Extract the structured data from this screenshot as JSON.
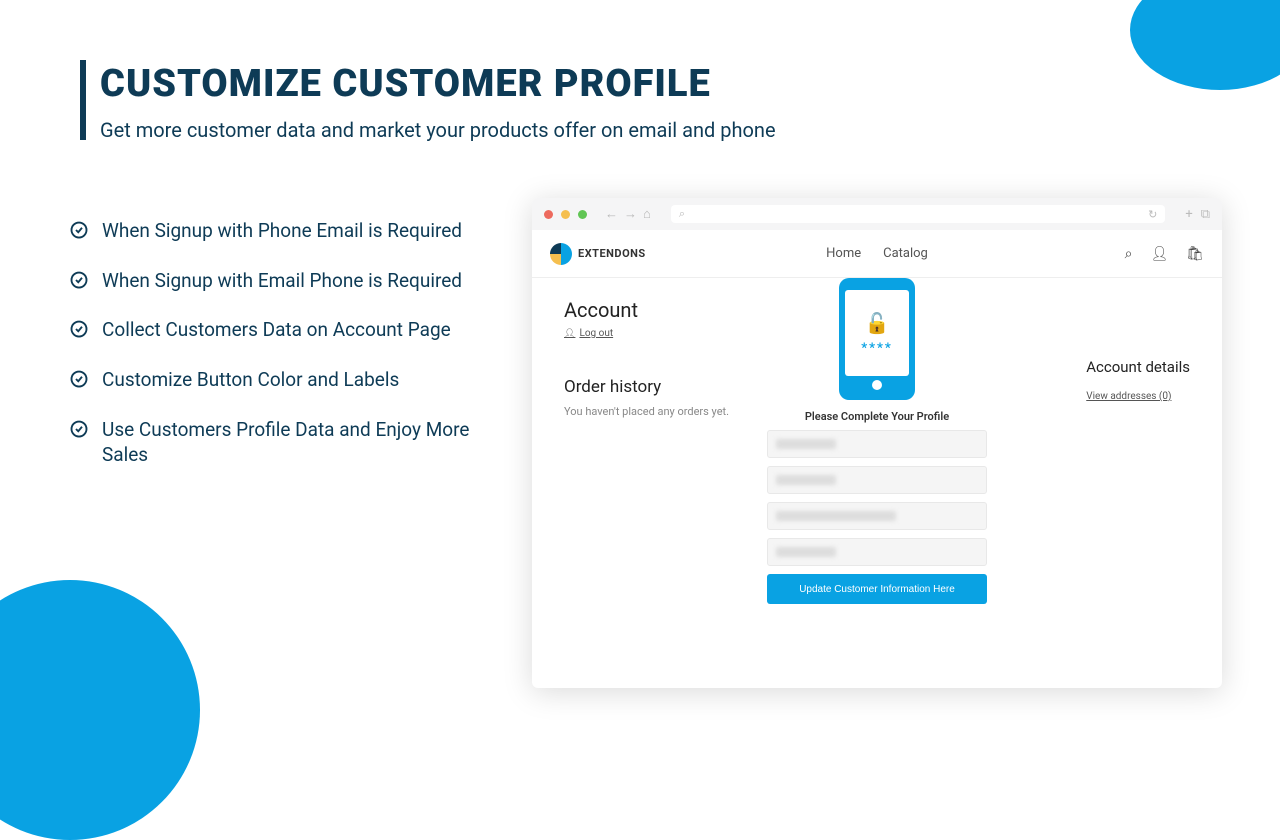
{
  "title": "CUSTOMIZE CUSTOMER PROFILE",
  "subtitle": "Get more customer data and market your products offer on email and phone",
  "features": [
    "When Signup with Phone Email is Required",
    "When Signup with Email Phone is Required",
    "Collect Customers Data on Account Page",
    "Customize Button Color and Labels",
    "Use Customers Profile Data and Enjoy More Sales"
  ],
  "brand": "EXTENDONS",
  "nav": {
    "home": "Home",
    "catalog": "Catalog"
  },
  "account": {
    "title": "Account",
    "logout": "Log out",
    "order_history": "Order history",
    "order_msg": "You haven't placed any orders yet.",
    "details_title": "Account details",
    "view_addresses": "View addresses (0)",
    "pin": "****",
    "prompt": "Please Complete Your Profile",
    "submit": "Update Customer Information Here"
  }
}
